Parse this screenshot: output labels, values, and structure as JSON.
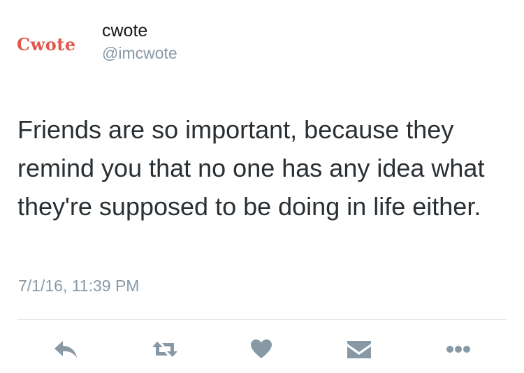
{
  "tweet": {
    "avatar_text": "Cwote",
    "display_name": "cwote",
    "handle": "@imcwote",
    "text": "Friends are so important, because they remind you that no one has any idea what they're supposed to be doing in life either.",
    "timestamp": "7/1/16, 11:39 PM"
  },
  "actions": [
    {
      "name": "reply",
      "icon": "reply-icon"
    },
    {
      "name": "retweet",
      "icon": "retweet-icon"
    },
    {
      "name": "like",
      "icon": "heart-icon"
    },
    {
      "name": "direct-message",
      "icon": "envelope-icon"
    },
    {
      "name": "more",
      "icon": "more-dots-icon"
    }
  ],
  "colors": {
    "icon_gray": "#8899a6",
    "brand_red": "#e2574c",
    "text": "#292f33",
    "divider": "#e1e8ed"
  }
}
